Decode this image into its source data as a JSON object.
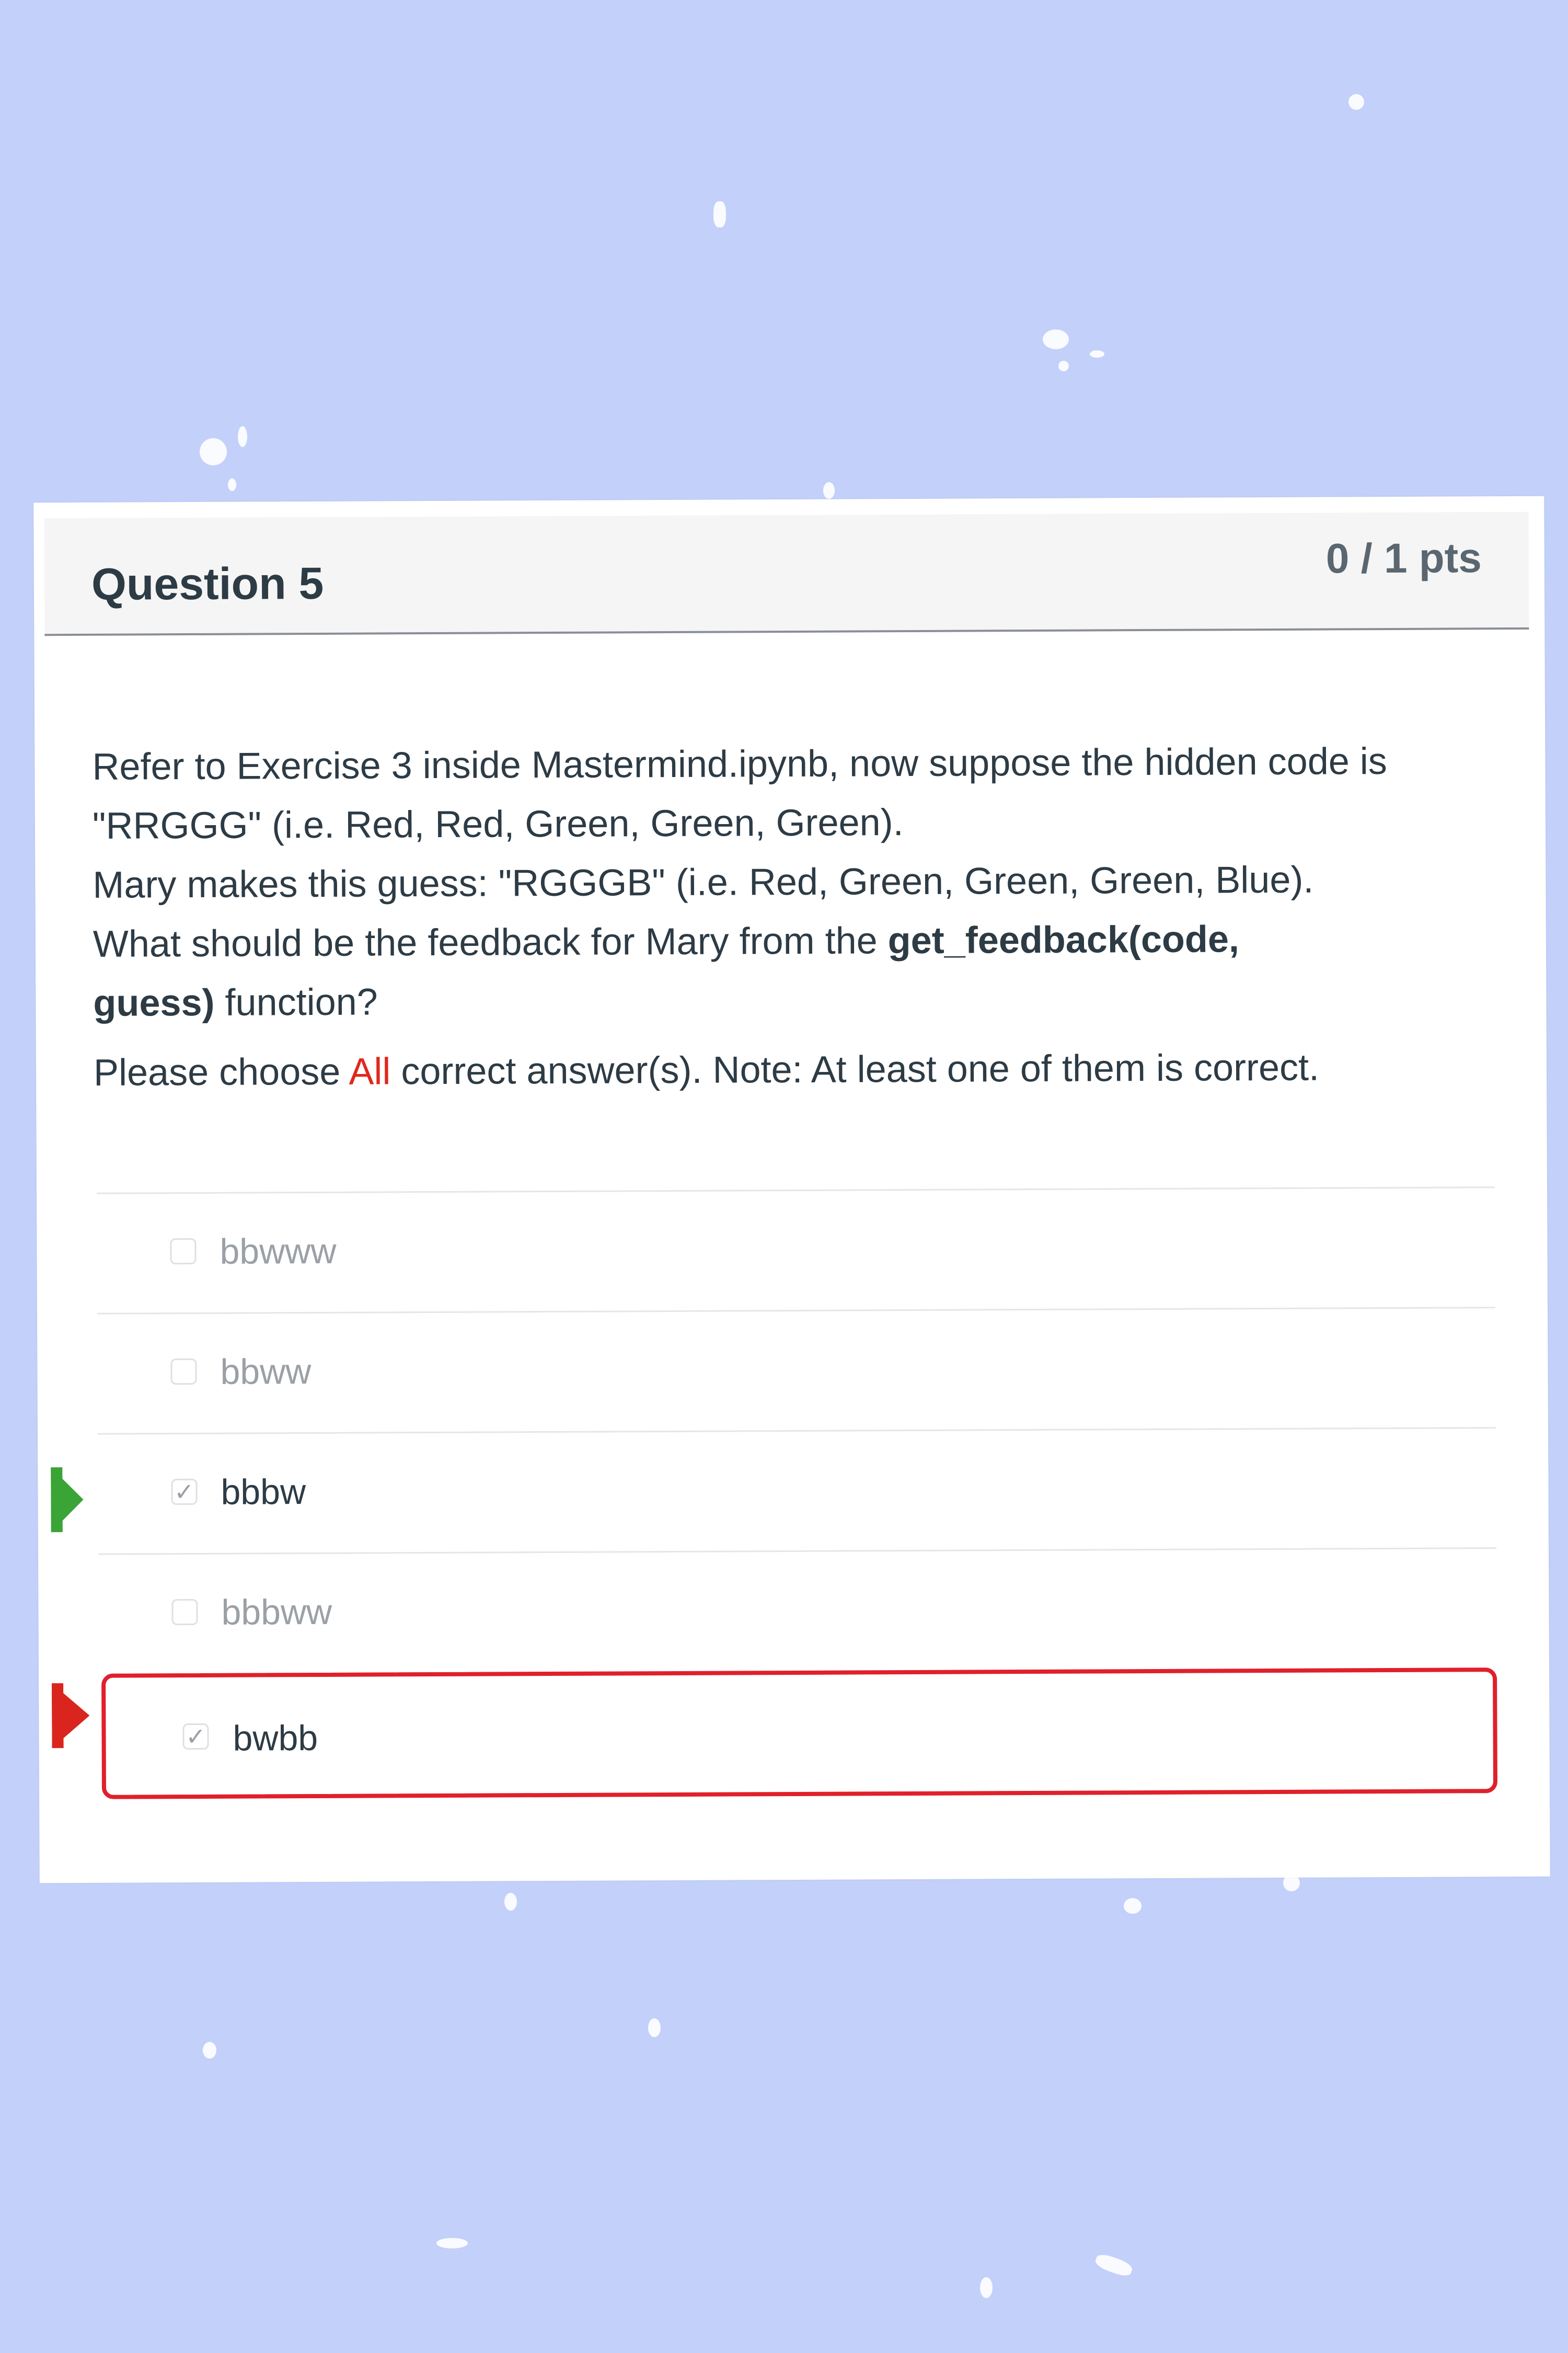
{
  "colors": {
    "background": "#c3d0fa",
    "card": "#ffffff",
    "header_bg": "#f5f5f5",
    "text": "#2d3b45",
    "accent_red": "#e0281d",
    "correct_marker": "#3aa436",
    "incorrect_marker": "#d9251d"
  },
  "question": {
    "title": "Question 5",
    "points": "0 / 1 pts",
    "text": {
      "line1": "Refer to Exercise 3 inside Mastermind.ipynb,  now suppose the hidden code is",
      "line2": "\"RRGGG\" (i.e. Red, Red, Green, Green, Green).",
      "line3": "Mary makes this guess: \"RGGGB\" (i.e. Red, Green, Green, Green, Blue).",
      "line4_prefix": "What should be the feedback for Mary from the ",
      "line4_bold": "get_feedback(code,",
      "line5_bold": "guess)",
      "line5_suffix": " function?"
    },
    "instruction": {
      "prefix": "Please choose ",
      "accent": "All",
      "suffix": " correct answer(s).  Note: At least one of them is correct."
    }
  },
  "answers": [
    {
      "label": "bbwww",
      "checked": false
    },
    {
      "label": "bbww",
      "checked": false
    },
    {
      "label": "bbbw",
      "checked": true,
      "marker": "correct"
    },
    {
      "label": "bbbww",
      "checked": false
    },
    {
      "label": "bwbb",
      "checked": true,
      "marker": "incorrect"
    }
  ],
  "icons": {
    "check": "✓",
    "correct_marker_icon": "green-arrow-icon",
    "incorrect_marker_icon": "red-arrow-icon"
  }
}
